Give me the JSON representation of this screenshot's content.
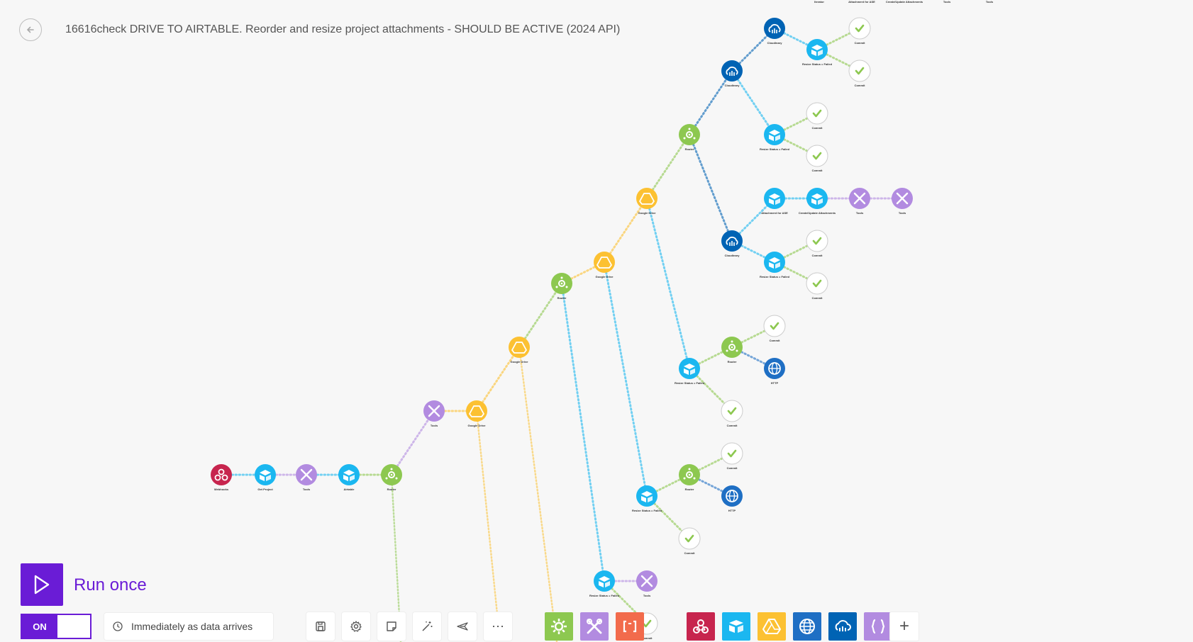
{
  "header": {
    "back_icon": "arrow-left-icon",
    "title": "16616check DRIVE TO AIRTABLE. Reorder and resize project attachments - SHOULD BE ACTIVE (2024 API)"
  },
  "colors": {
    "webhooks": "#c7254e",
    "airtable": "#1bb7f0",
    "tools": "#b28be0",
    "router": "#8dc850",
    "drive": "#fcc132",
    "cloudinary": "#0063b4",
    "http": "#1f6fc4",
    "commit": "#ffffff",
    "accent": "#6a1cd6",
    "json": "#b28be0",
    "iterator": "#f26b4c"
  },
  "nodes": [
    {
      "label": "Webhooks",
      "type": "webhooks"
    },
    {
      "label": "Get Project",
      "type": "airtable"
    },
    {
      "label": "Tools",
      "type": "tools"
    },
    {
      "label": "Airtable",
      "type": "airtable"
    },
    {
      "label": "Router",
      "type": "router"
    },
    {
      "label": "Tools",
      "type": "tools"
    },
    {
      "label": "Google Drive",
      "type": "drive"
    },
    {
      "label": "Google Drive",
      "type": "drive"
    },
    {
      "label": "Router",
      "type": "router"
    },
    {
      "label": "Google Drive",
      "type": "drive"
    },
    {
      "label": "Google Drive",
      "type": "drive"
    },
    {
      "label": "Router",
      "type": "router"
    },
    {
      "label": "Cloudinary",
      "type": "cloudinary"
    },
    {
      "label": "Cloudinary",
      "type": "cloudinary"
    },
    {
      "label": "Resize Status = Failed",
      "type": "airtable"
    },
    {
      "label": "Commit",
      "type": "commit"
    },
    {
      "label": "Commit",
      "type": "commit"
    },
    {
      "label": "Resize Status = Failed",
      "type": "airtable"
    },
    {
      "label": "Commit",
      "type": "commit"
    },
    {
      "label": "Commit",
      "type": "commit"
    },
    {
      "label": "Cloudinary",
      "type": "cloudinary"
    },
    {
      "label": "Attachment for ASE",
      "type": "airtable"
    },
    {
      "label": "Create/Update Attachments",
      "type": "airtable"
    },
    {
      "label": "Tools",
      "type": "tools"
    },
    {
      "label": "Tools",
      "type": "tools"
    },
    {
      "label": "Resize Status = Failed",
      "type": "airtable"
    },
    {
      "label": "Commit",
      "type": "commit"
    },
    {
      "label": "Commit",
      "type": "commit"
    },
    {
      "label": "Resize Status = Failed",
      "type": "airtable"
    },
    {
      "label": "Router",
      "type": "router"
    },
    {
      "label": "Commit",
      "type": "commit"
    },
    {
      "label": "HTTP",
      "type": "http"
    },
    {
      "label": "Commit",
      "type": "commit"
    },
    {
      "label": "Resize Status = Failed",
      "type": "airtable"
    },
    {
      "label": "Router",
      "type": "router"
    },
    {
      "label": "Commit",
      "type": "commit"
    },
    {
      "label": "HTTP",
      "type": "http"
    },
    {
      "label": "Commit",
      "type": "commit"
    },
    {
      "label": "Resize Status = Failed",
      "type": "airtable"
    },
    {
      "label": "Tools",
      "type": "tools"
    },
    {
      "label": "Commit",
      "type": "commit"
    }
  ],
  "top_labels": [
    "Iterator",
    "Attachment for ASE",
    "Create/Update Attachments",
    "Tools",
    "Tools"
  ],
  "run_once": {
    "label": "Run once",
    "icon": "play-icon"
  },
  "toggle": {
    "label": "ON"
  },
  "schedule": {
    "label": "Immediately as data arrives",
    "icon": "clock-icon"
  },
  "toolbar_icons": [
    "save-icon",
    "settings-gear-icon",
    "notes-icon",
    "auto-align-wand-icon",
    "explain-flow-plane-icon",
    "more-dots-icon"
  ],
  "app_icons": [
    {
      "name": "flow-control-icon",
      "color": "#8dc850"
    },
    {
      "name": "tools-icon",
      "color": "#b28be0"
    },
    {
      "name": "text-parser-icon",
      "color": "#f26b4c"
    },
    {
      "name": "webhooks-icon",
      "color": "#c7254e"
    },
    {
      "name": "airtable-icon",
      "color": "#1bb7f0"
    },
    {
      "name": "google-drive-icon",
      "color": "#fcc132"
    },
    {
      "name": "http-icon",
      "color": "#1f6fc4"
    },
    {
      "name": "cloudinary-icon",
      "color": "#0063b4"
    },
    {
      "name": "json-icon",
      "color": "#b28be0"
    }
  ],
  "add_module_icon": "plus-icon"
}
